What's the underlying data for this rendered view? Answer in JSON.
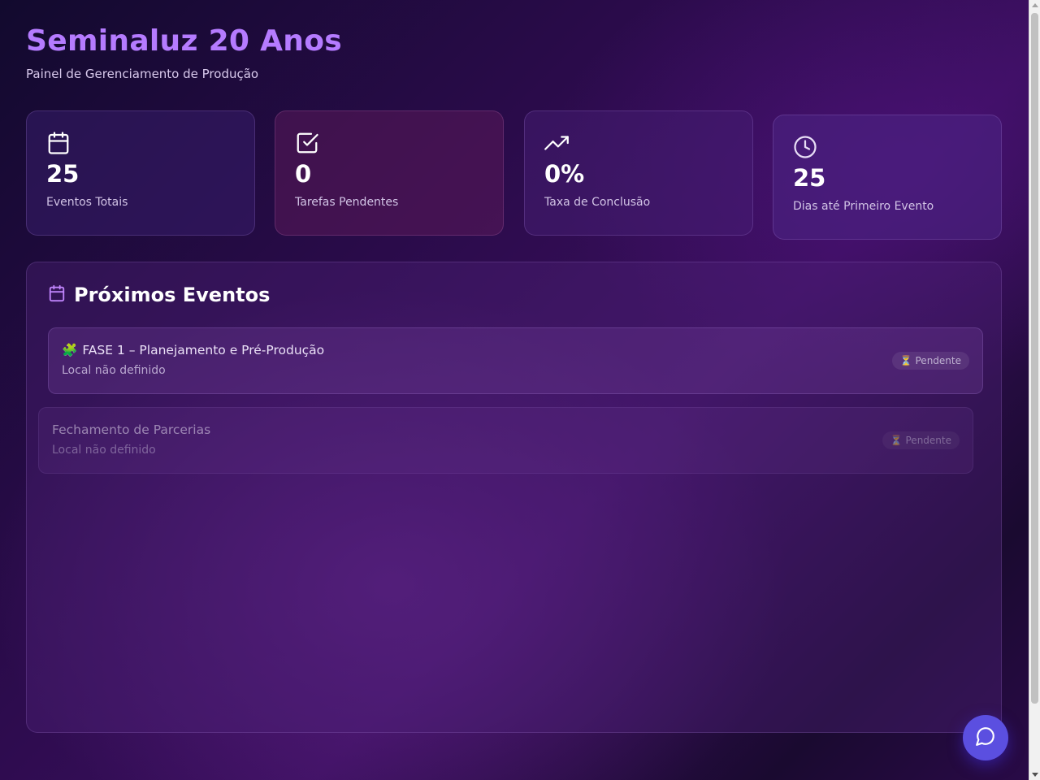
{
  "header": {
    "title": "Seminaluz 20 Anos",
    "subtitle": "Painel de Gerenciamento de Produção"
  },
  "stats": [
    {
      "icon": "calendar-icon",
      "value": "25",
      "label": "Eventos Totais"
    },
    {
      "icon": "check-square-icon",
      "value": "0",
      "label": "Tarefas Pendentes"
    },
    {
      "icon": "trending-up-icon",
      "value": "0%",
      "label": "Taxa de Conclusão"
    },
    {
      "icon": "clock-icon",
      "value": "25",
      "label": "Dias até Primeiro Evento"
    }
  ],
  "events_panel": {
    "title": "Próximos Eventos",
    "icon": "calendar-icon",
    "events": [
      {
        "emoji": "🧩",
        "title": "FASE 1 – Planejamento e Pré-Produção",
        "location": "Local não definido",
        "status_icon": "⏳",
        "status": "Pendente"
      },
      {
        "emoji": "",
        "title": "Fechamento de Parcerias",
        "location": "Local não definido",
        "status_icon": "⏳",
        "status": "Pendente"
      }
    ]
  },
  "chat": {
    "icon": "chat-bubble-icon"
  },
  "colors": {
    "title_accent": "#b57bff",
    "chat_button": "#5b4fe0",
    "calendar_icon_header": "#c084fc"
  }
}
